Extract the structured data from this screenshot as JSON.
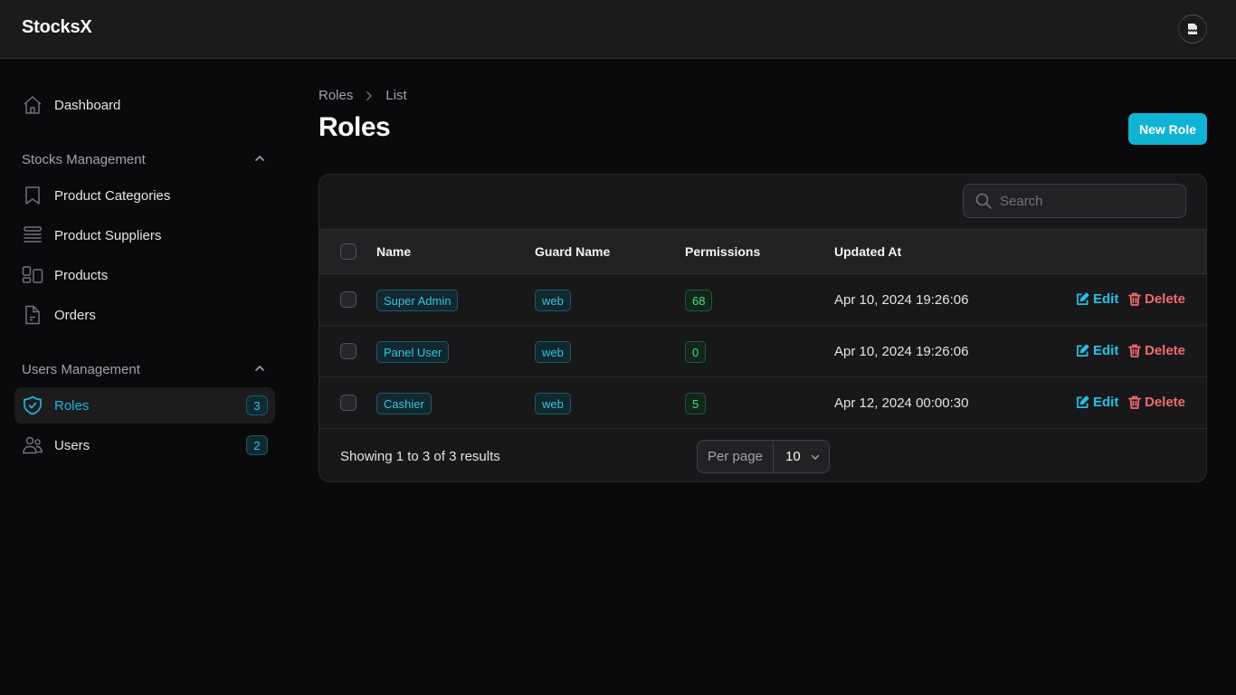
{
  "app": {
    "title": "StocksX"
  },
  "user": {
    "avatar_icon": "broken-image-icon"
  },
  "sidebar": {
    "top_items": [
      {
        "label": "Dashboard",
        "icon": "home-icon"
      }
    ],
    "groups": [
      {
        "label": "Stocks Management",
        "collapse_icon": "chevron-up-icon",
        "items": [
          {
            "label": "Product Categories",
            "icon": "bookmark-icon"
          },
          {
            "label": "Product Suppliers",
            "icon": "queue-list-icon"
          },
          {
            "label": "Products",
            "icon": "squares-icon"
          },
          {
            "label": "Orders",
            "icon": "document-icon"
          }
        ]
      },
      {
        "label": "Users Management",
        "collapse_icon": "chevron-up-icon",
        "items": [
          {
            "label": "Roles",
            "icon": "shield-check-icon",
            "badge": "3",
            "active": true
          },
          {
            "label": "Users",
            "icon": "users-icon",
            "badge": "2"
          }
        ]
      }
    ]
  },
  "breadcrumb": [
    "Roles",
    "List"
  ],
  "page": {
    "title": "Roles",
    "new_button": "New Role"
  },
  "table": {
    "search_placeholder": "Search",
    "columns": [
      "Name",
      "Guard Name",
      "Permissions",
      "Updated At"
    ],
    "rows": [
      {
        "name": "Super Admin",
        "guard": "web",
        "permissions": "68",
        "updated_at": "Apr 10, 2024 19:26:06"
      },
      {
        "name": "Panel User",
        "guard": "web",
        "permissions": "0",
        "updated_at": "Apr 10, 2024 19:26:06"
      },
      {
        "name": "Cashier",
        "guard": "web",
        "permissions": "5",
        "updated_at": "Apr 12, 2024 00:00:30"
      }
    ],
    "actions": {
      "edit": "Edit",
      "delete": "Delete"
    },
    "footer": {
      "showing": "Showing 1 to 3 of 3 results",
      "per_page_label": "Per page",
      "per_page_value": "10"
    }
  },
  "colors": {
    "accent": "#0fb3d4",
    "danger": "#f06b6b",
    "success": "#4ade80",
    "background": "#0a0a0c",
    "surface": "#18181b"
  }
}
